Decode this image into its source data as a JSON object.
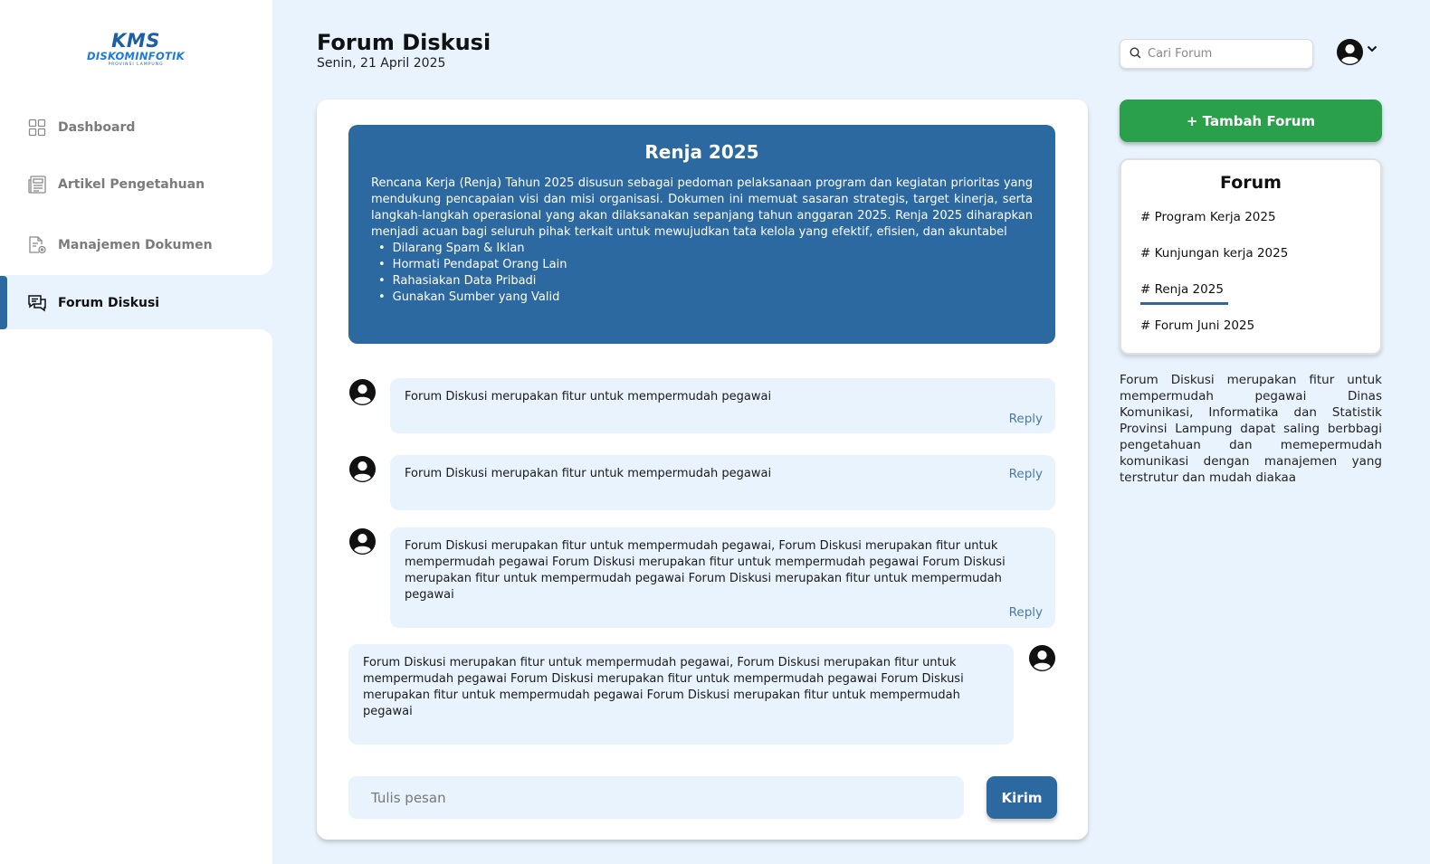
{
  "logo": {
    "line1": "KMS",
    "line2": "DISKOMINFOTIK",
    "line3": "PROVINSI LAMPUNG"
  },
  "sidebar": {
    "items": [
      {
        "label": "Dashboard",
        "icon": "grid-icon"
      },
      {
        "label": "Artikel Pengetahuan",
        "icon": "newspaper-icon"
      },
      {
        "label": "Manajemen Dokumen",
        "icon": "document-settings-icon"
      },
      {
        "label": "Forum Diskusi",
        "icon": "chat-icon",
        "active": true
      }
    ]
  },
  "header": {
    "title": "Forum Diskusi",
    "date": "Senin, 21 April 2025",
    "search_placeholder": "Cari Forum"
  },
  "banner": {
    "title": "Renja 2025",
    "description": "Rencana Kerja (Renja) Tahun 2025 disusun sebagai pedoman pelaksanaan program dan kegiatan prioritas yang mendukung pencapaian visi dan misi organisasi. Dokumen ini memuat sasaran strategis, target kinerja, serta langkah-langkah operasional yang akan dilaksanakan sepanjang tahun anggaran 2025. Renja 2025 diharapkan menjadi acuan bagi seluruh pihak terkait untuk mewujudkan tata kelola yang efektif, efisien, dan akuntabel",
    "rules": [
      "Dilarang Spam & Iklan",
      "Hormati Pendapat Orang Lain",
      "Rahasiakan Data Pribadi",
      "Gunakan Sumber yang Valid"
    ]
  },
  "messages": [
    {
      "text": "Forum Diskusi merupakan fitur untuk mempermudah pegawai",
      "reply": "Reply"
    },
    {
      "text": "Forum Diskusi merupakan fitur untuk mempermudah pegawai",
      "reply": "Reply"
    },
    {
      "text": "Forum Diskusi merupakan fitur untuk mempermudah pegawai, Forum Diskusi merupakan fitur untuk mempermudah pegawai Forum Diskusi merupakan fitur untuk mempermudah pegawai Forum Diskusi merupakan fitur untuk mempermudah pegawai Forum Diskusi merupakan fitur untuk mempermudah pegawai",
      "reply": "Reply"
    },
    {
      "text": "Forum Diskusi merupakan fitur untuk mempermudah pegawai, Forum Diskusi merupakan fitur untuk mempermudah pegawai Forum Diskusi merupakan fitur untuk mempermudah pegawai Forum Diskusi merupakan fitur untuk mempermudah pegawai Forum Diskusi merupakan fitur untuk mempermudah pegawai",
      "own": true
    }
  ],
  "composer": {
    "placeholder": "Tulis pesan",
    "send_label": "Kirim"
  },
  "right_panel": {
    "add_label": "+ Tambah Forum",
    "forum_title": "Forum",
    "forums": [
      "# Program Kerja 2025",
      "# Kunjungan kerja 2025",
      "# Renja 2025",
      "# Forum Juni 2025"
    ],
    "active_forum": "# Renja 2025",
    "info": "Forum Diskusi merupakan fitur untuk mempermudah pegawai Dinas Komunikasi, Informatika dan Statistik Provinsi Lampung dapat saling berbbagi pengetahuan dan memepermudah komunikasi dengan manajemen yang terstrutur dan mudah diakaa"
  },
  "colors": {
    "primary": "#2c69a0",
    "success": "#2aa04a",
    "background": "#e8f3fd",
    "bubble": "#e8f3fd"
  }
}
